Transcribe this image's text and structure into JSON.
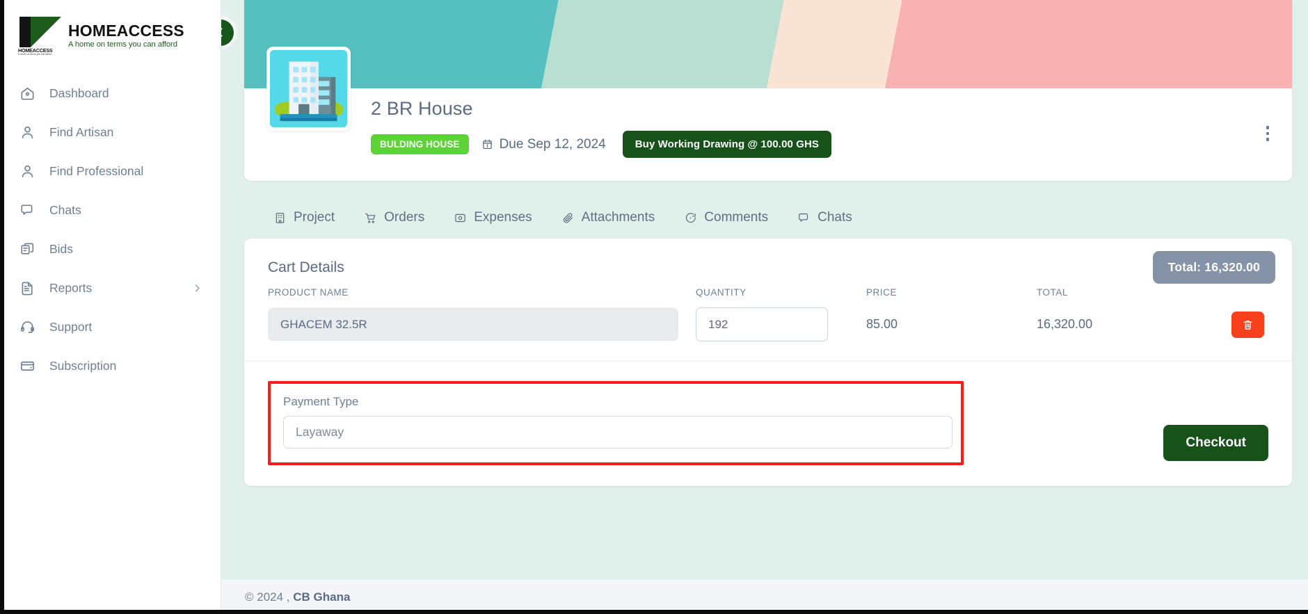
{
  "brand": {
    "name": "HOMEACCESS",
    "tagline": "A home on terms you can afford",
    "logo_word": "HOMEACCESS",
    "logo_subword": "A home on terms you can afford"
  },
  "sidebar": {
    "items": [
      {
        "label": "Dashboard",
        "icon": "home-icon",
        "chevron": ""
      },
      {
        "label": "Find Artisan",
        "icon": "user-icon",
        "chevron": ""
      },
      {
        "label": "Find Professional",
        "icon": "user-icon",
        "chevron": ""
      },
      {
        "label": "Chats",
        "icon": "chat-icon",
        "chevron": ""
      },
      {
        "label": "Bids",
        "icon": "copy-icon",
        "chevron": ""
      },
      {
        "label": "Reports",
        "icon": "document-icon",
        "chevron": "›"
      },
      {
        "label": "Support",
        "icon": "headset-icon",
        "chevron": ""
      },
      {
        "label": "Subscription",
        "icon": "card-icon",
        "chevron": ""
      }
    ]
  },
  "back_button": {
    "icon": "chevron-left-icon"
  },
  "project": {
    "title": "2 BR House",
    "type_badge": "BULDING HOUSE",
    "due_label": "Due Sep 12, 2024",
    "due_icon": "calendar-alert-icon",
    "buy_button": "Buy Working Drawing @ 100.00 GHS",
    "menu_icon": "kebab-menu-icon",
    "thumbnail_icon": "building-icon"
  },
  "tabs": [
    {
      "label": "Project",
      "icon": "building-small-icon"
    },
    {
      "label": "Orders",
      "icon": "cart-icon"
    },
    {
      "label": "Expenses",
      "icon": "money-icon"
    },
    {
      "label": "Attachments",
      "icon": "paperclip-icon"
    },
    {
      "label": "Comments",
      "icon": "comment-icon"
    },
    {
      "label": "Chats",
      "icon": "chat-bubble-icon"
    }
  ],
  "cart": {
    "title": "Cart Details",
    "total_badge": "Total: 16,320.00",
    "columns": [
      "PRODUCT NAME",
      "QUANTITY",
      "PRICE",
      "TOTAL"
    ],
    "rows": [
      {
        "product_name": "GHACEM 32.5R",
        "quantity": "192",
        "price": "85.00",
        "total": "16,320.00",
        "delete_icon": "trash-icon"
      }
    ]
  },
  "payment": {
    "label": "Payment Type",
    "value": "Layaway",
    "highlight_color": "#fb1b1b",
    "checkout_label": "Checkout"
  },
  "footer": {
    "copyright": "© 2024 ,",
    "company": "CB Ghana"
  },
  "colors": {
    "brand_green": "#17521a",
    "badge_green": "#5dd338",
    "danger_red": "#f8401d",
    "total_grey": "#8593a8",
    "page_bg": "#e1f0ea"
  }
}
